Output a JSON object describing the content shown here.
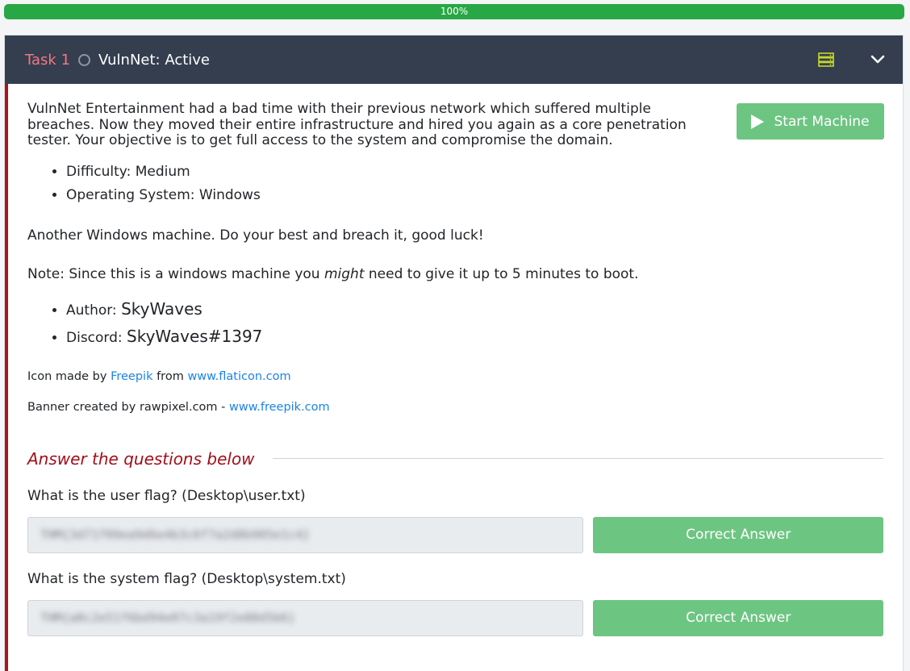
{
  "progress": {
    "label": "100%",
    "percent": 100,
    "color": "#28a745"
  },
  "task": {
    "number": "Task 1",
    "title": "VulnNet: Active",
    "header_bg": "#343e4f",
    "accent": "#b10f1d"
  },
  "icons": {
    "status": "circle-outline-icon",
    "server": "server-icon",
    "expand": "chevron-down-icon",
    "play": "play-icon"
  },
  "start_button": {
    "label": "Start Machine",
    "color": "#6dc582"
  },
  "description": "VulnNet Entertainment had a bad time with their previous network which suffered multiple breaches. Now they moved their entire infrastructure and hired you again as a core penetration tester. Your objective is to get full access to the system and compromise the domain.",
  "details": [
    "Difficulty: Medium",
    "Operating System: Windows"
  ],
  "closing": "Another Windows machine. Do your best and breach it, good luck!",
  "note": {
    "prefix": "Note: Since this is a windows machine you ",
    "emphasis": "might",
    "suffix": " need to give it up to 5 minutes to boot."
  },
  "credits": {
    "author_label": "Author: ",
    "author_value": "SkyWaves",
    "discord_label": "Discord: ",
    "discord_value": "SkyWaves#1397"
  },
  "attribution": {
    "icon_prefix": "Icon made by ",
    "icon_author": "Freepik",
    "icon_mid": " from ",
    "icon_site": "www.flaticon.com",
    "banner_prefix": "Banner created by rawpixel.com - ",
    "banner_site": "www.freepik.com"
  },
  "answers": {
    "heading": "Answer the questions below",
    "questions": [
      {
        "text": "What is the user flag? (Desktop\\user.txt)",
        "answer": "THM{3d71f09ea9d6e4b3c6f7a2d8b905e1c4}",
        "button": "Correct Answer"
      },
      {
        "text": "What is the system flag? (Desktop\\system.txt)",
        "answer": "THM{a8c2e51f6bd94e07c3a19f2e88d5b6}",
        "button": "Correct Answer"
      }
    ]
  }
}
